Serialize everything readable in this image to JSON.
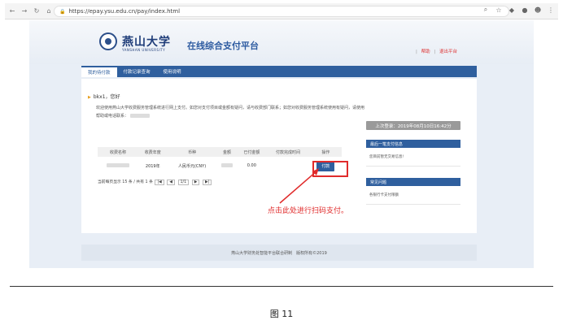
{
  "browser": {
    "url": "https://epay.ysu.edu.cn/pay/index.html",
    "icons": [
      "back-icon",
      "forward-icon",
      "reload-icon",
      "home-icon"
    ]
  },
  "header": {
    "logo_cn": "燕山大学",
    "logo_en": "YANSHAN UNIVERSITY",
    "site_title": "在线综合支付平台",
    "help": "帮助",
    "logout": "退出平台"
  },
  "nav": {
    "tabs": [
      {
        "label": "我的待付款"
      },
      {
        "label": "付款记录查询"
      },
      {
        "label": "使用说明"
      }
    ]
  },
  "main": {
    "greeting": "bkx1，您好",
    "intro": "欢迎使用燕山大学收费服务管理系统进行网上支付。如您对支付项目或金额有疑问，请与收费部门联系；如您对收费服务管理系统使用有疑问，请使用帮助或电话联系："
  },
  "side": {
    "last_login": "上次登录：2019年08月10日16:42分",
    "recent_title": "最后一笔支付信息",
    "recent_body": "您目前暂无交易信息!",
    "faq_title": "常见问题",
    "faq_body": "各银行卡支付限额"
  },
  "table": {
    "headers": [
      "收费名称",
      "收费年度",
      "币种",
      "金额",
      "已付金额",
      "付款完成时间",
      "操作"
    ],
    "row": {
      "year": "2019年",
      "currency": "人民币元(CNY)",
      "paid": "0.00",
      "pay_button": "付款"
    },
    "pager": "当前每页显示 15 条 / 共有 1 条",
    "page_label": "1/1"
  },
  "annotation": {
    "callout": "点击此处进行扫码支付。"
  },
  "footer": {
    "text": "燕山大学财务处智能平台联合研制　版权所有©2019"
  },
  "caption": "图 11"
}
